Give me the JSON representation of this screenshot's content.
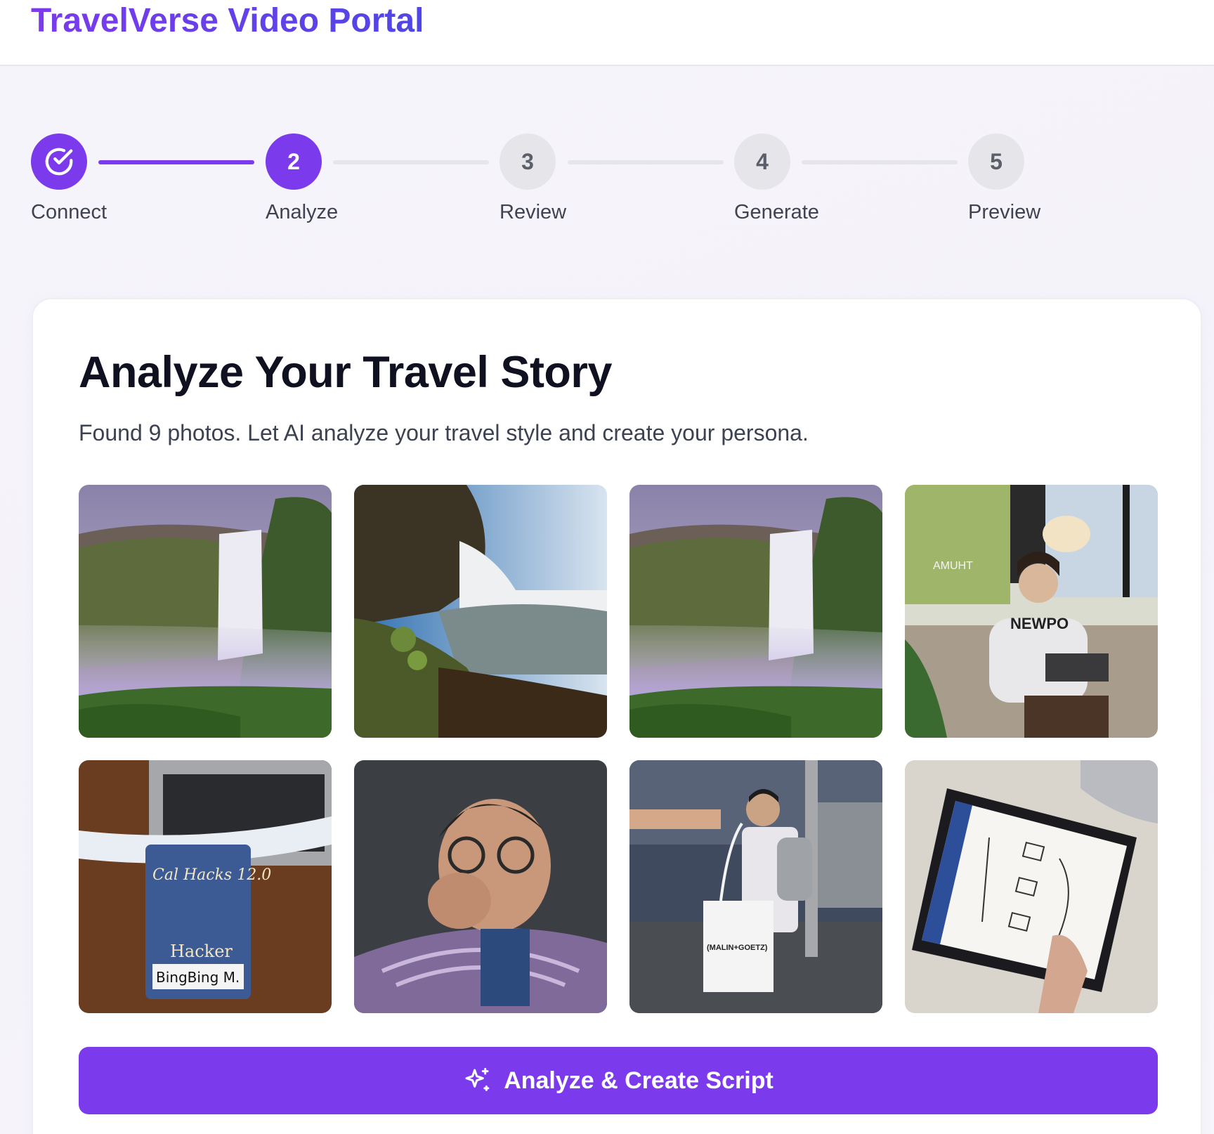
{
  "header": {
    "title": "TravelVerse Video Portal"
  },
  "stepper": {
    "steps": [
      {
        "number": "1",
        "label": "Connect",
        "status": "done"
      },
      {
        "number": "2",
        "label": "Analyze",
        "status": "active"
      },
      {
        "number": "3",
        "label": "Review",
        "status": "pending"
      },
      {
        "number": "4",
        "label": "Generate",
        "status": "pending"
      },
      {
        "number": "5",
        "label": "Preview",
        "status": "pending"
      }
    ]
  },
  "card": {
    "title": "Analyze Your Travel Story",
    "subtitle": "Found 9 photos. Let AI analyze your travel style and create your persona.",
    "photos": [
      {
        "subject": "waterfall-misty-cliffs"
      },
      {
        "subject": "waterfall-river-rocks"
      },
      {
        "subject": "waterfall-misty-cliffs"
      },
      {
        "subject": "person-laptop-cafe"
      },
      {
        "subject": "hackathon-badge-laptop"
      },
      {
        "subject": "person-thinking-portrait"
      },
      {
        "subject": "person-shopping-bag-street"
      },
      {
        "subject": "tablet-handwritten-notes"
      }
    ],
    "photo_text": {
      "badge": "Cal Hacks 12.0",
      "badge_role": "Hacker",
      "badge_name": "BingBing M.",
      "bag": "(MALIN+GOETZ)",
      "cafe": "AMUHT",
      "shirt": "NEWPO"
    },
    "cta_label": "Analyze & Create Script"
  },
  "colors": {
    "accent": "#7c3aed",
    "pending": "#e6e6ea"
  }
}
